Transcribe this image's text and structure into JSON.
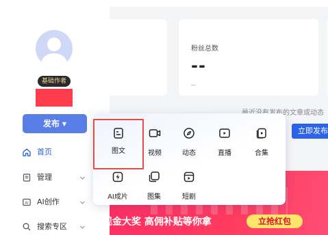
{
  "sidebar": {
    "badge": "基础作者",
    "publish_button": "发布",
    "nav": [
      {
        "label": "首页",
        "icon": "home-icon",
        "active": true
      },
      {
        "label": "管理",
        "icon": "doc-icon",
        "active": false
      },
      {
        "label": "AI创作",
        "icon": "ai-icon",
        "active": false
      },
      {
        "label": "搜索专区",
        "icon": "search-icon",
        "active": false
      }
    ]
  },
  "main": {
    "fans_card": {
      "label": "粉丝总数",
      "value": "--",
      "sub": "--"
    },
    "empty_note": "最近没有发布的文章或动态",
    "publish_now": "立即发布",
    "banner": {
      "text": "现金大奖 高佣补贴等你拿",
      "button": "立抢红包"
    }
  },
  "publish_menu": {
    "items": [
      {
        "label": "图文",
        "icon": "image-text-icon"
      },
      {
        "label": "视频",
        "icon": "video-icon"
      },
      {
        "label": "动态",
        "icon": "compass-icon"
      },
      {
        "label": "直播",
        "icon": "live-icon"
      },
      {
        "label": "合集",
        "icon": "collection-icon"
      },
      {
        "label": "AI成片",
        "icon": "ai-film-icon"
      },
      {
        "label": "图集",
        "icon": "gallery-icon"
      },
      {
        "label": "短剧",
        "icon": "short-drama-icon"
      }
    ]
  },
  "colors": {
    "primary": "#2d63e6",
    "publish_button": "#5a7ee8",
    "highlight": "#e44b43",
    "banner": "#ff2e63"
  }
}
